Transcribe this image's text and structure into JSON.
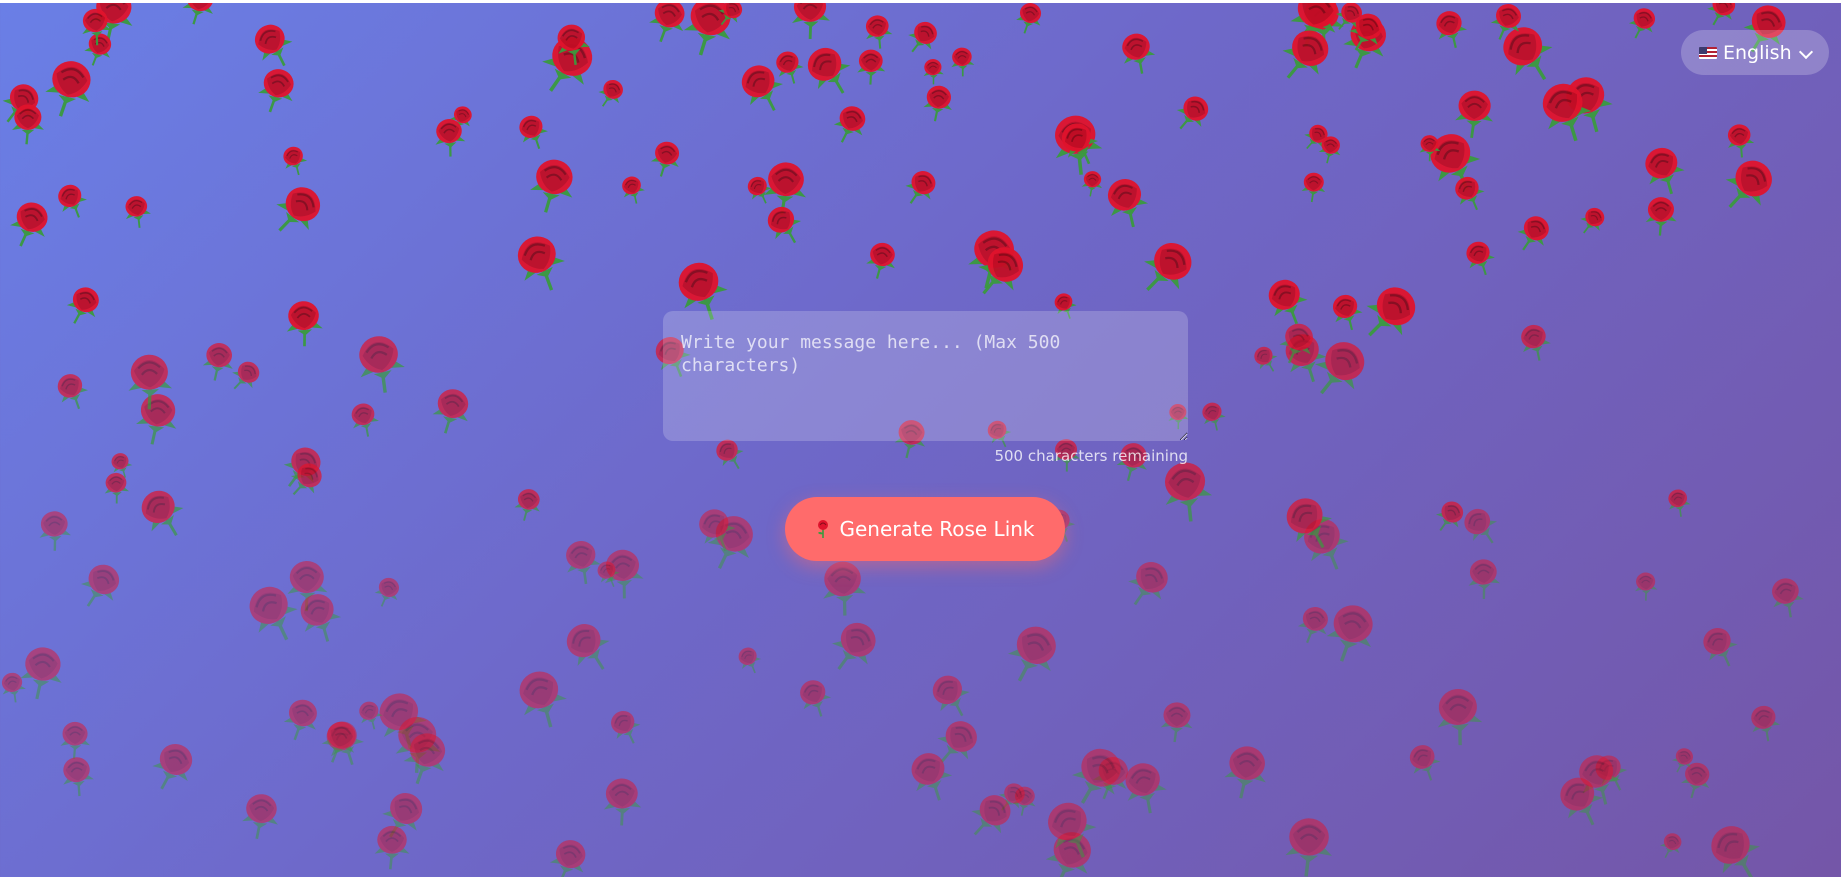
{
  "language_selector": {
    "selected": "English",
    "flag_icon": "us-flag-icon",
    "chevron_icon": "chevron-down-icon"
  },
  "message": {
    "value": "",
    "placeholder": "Write your message here... (Max 500 characters)"
  },
  "counter": {
    "text": "500 characters remaining"
  },
  "generate": {
    "label": "Generate Rose Link",
    "icon": "rose-icon"
  },
  "colors": {
    "background_start": "#6a7fe6",
    "background_end": "#7456a8",
    "button": "#ff6b6b",
    "rose_red": "#e0142d",
    "leaf_green": "#3a9a3f"
  },
  "decoration": {
    "falling_rose_icon": "rose-icon"
  }
}
